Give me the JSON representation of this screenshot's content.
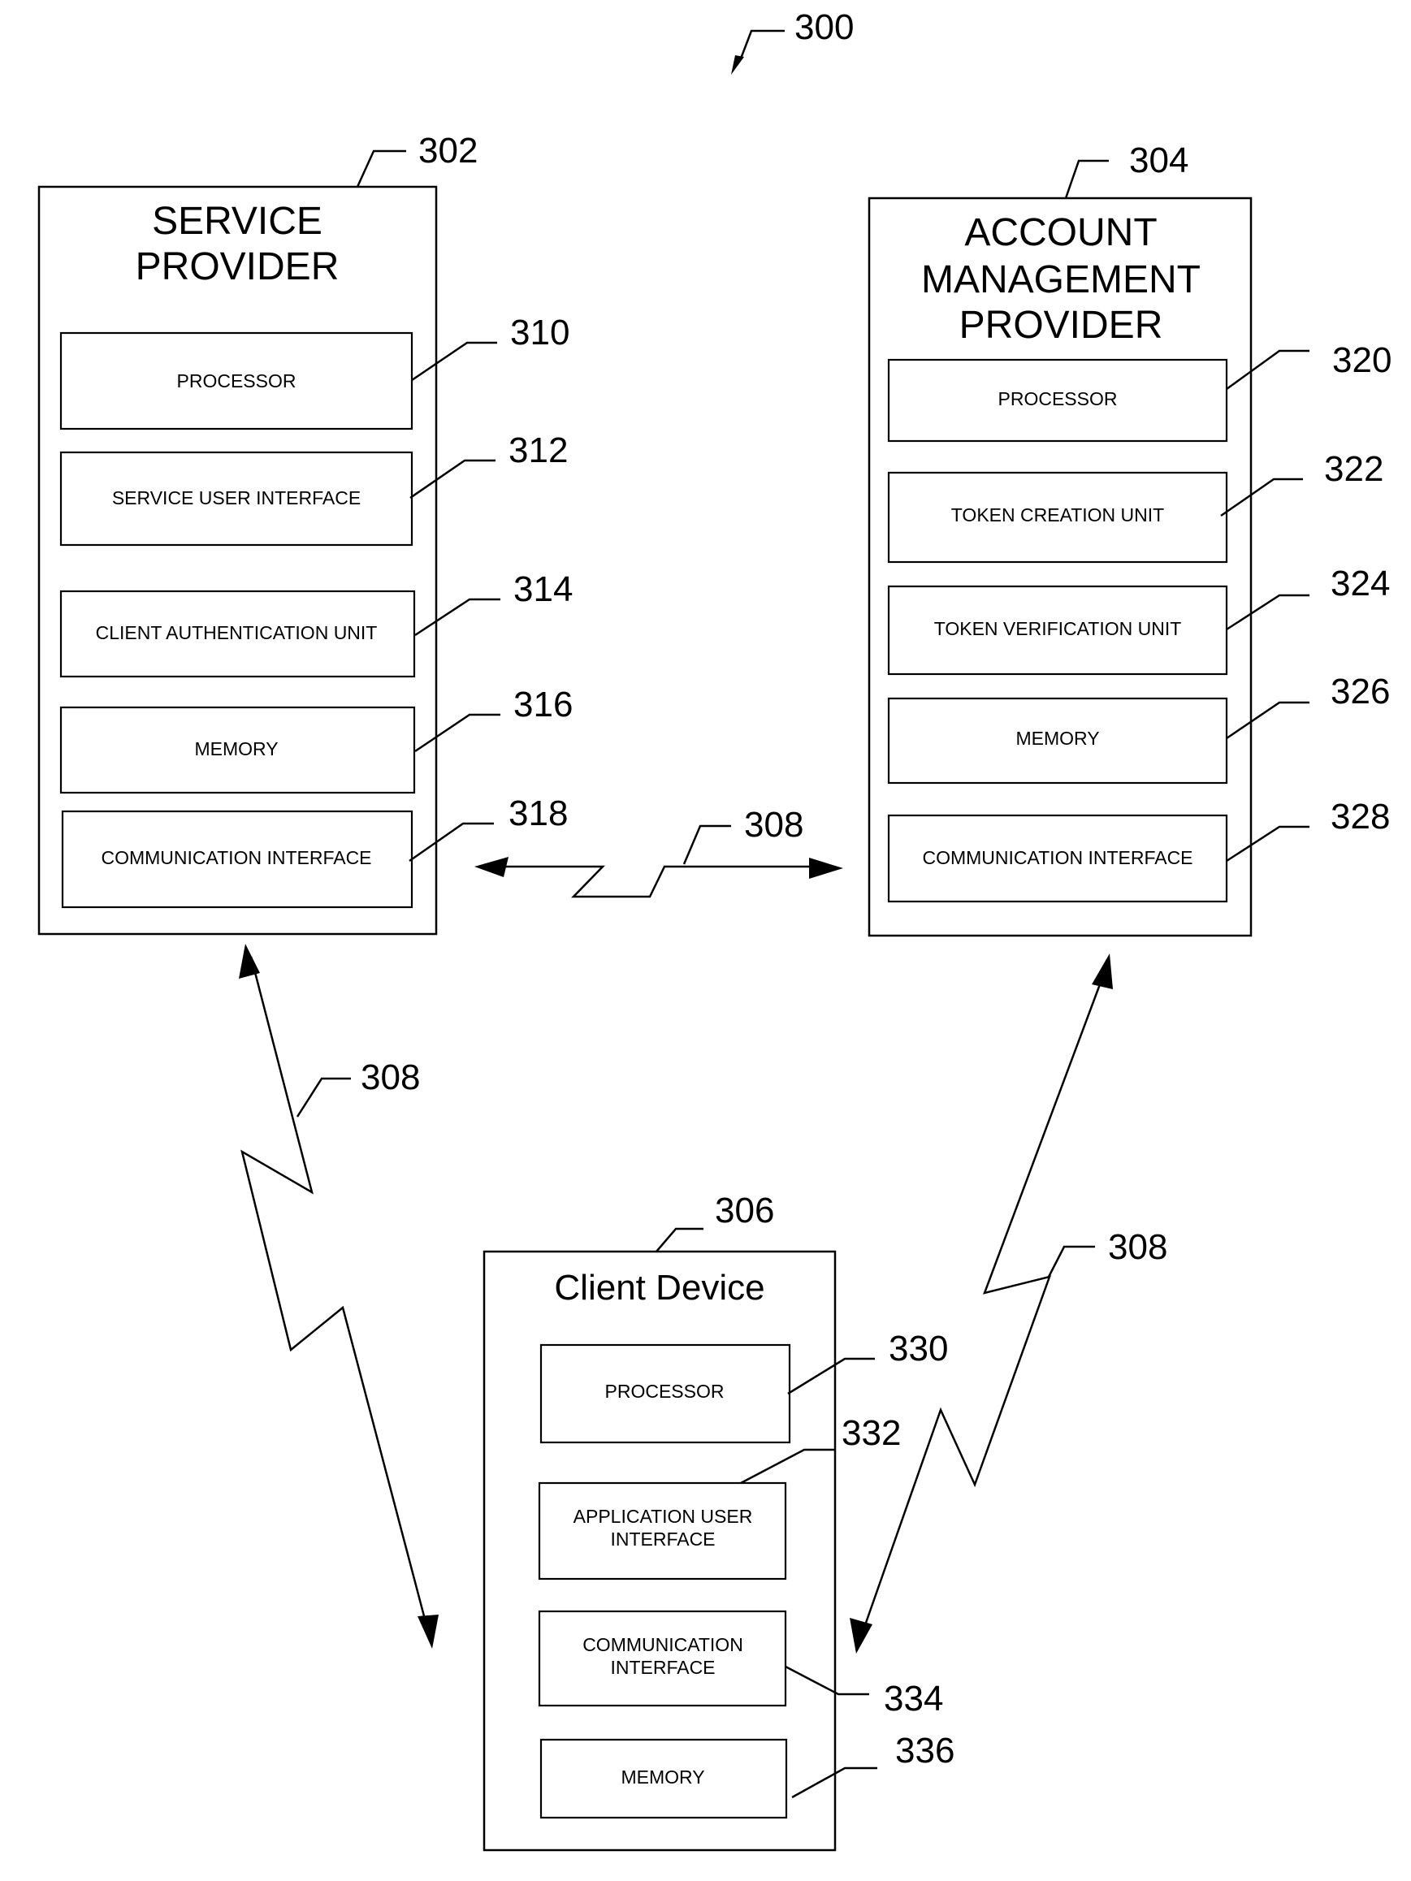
{
  "figure": {
    "ref": "300",
    "network_ref": "308"
  },
  "service_provider": {
    "ref": "302",
    "title": [
      "SERVICE",
      "PROVIDER"
    ],
    "components": [
      {
        "ref": "310",
        "label": [
          "PROCESSOR"
        ]
      },
      {
        "ref": "312",
        "label": [
          "SERVICE USER INTERFACE"
        ]
      },
      {
        "ref": "314",
        "label": [
          "CLIENT AUTHENTICATION UNIT"
        ]
      },
      {
        "ref": "316",
        "label": [
          "MEMORY"
        ]
      },
      {
        "ref": "318",
        "label": [
          "COMMUNICATION INTERFACE"
        ]
      }
    ]
  },
  "account_management_provider": {
    "ref": "304",
    "title": [
      "ACCOUNT",
      "MANAGEMENT",
      "PROVIDER"
    ],
    "components": [
      {
        "ref": "320",
        "label": [
          "PROCESSOR"
        ]
      },
      {
        "ref": "322",
        "label": [
          "TOKEN CREATION UNIT"
        ]
      },
      {
        "ref": "324",
        "label": [
          "TOKEN VERIFICATION UNIT"
        ]
      },
      {
        "ref": "326",
        "label": [
          "MEMORY"
        ]
      },
      {
        "ref": "328",
        "label": [
          "COMMUNICATION INTERFACE"
        ]
      }
    ]
  },
  "client_device": {
    "ref": "306",
    "title": [
      "Client Device"
    ],
    "components": [
      {
        "ref": "330",
        "label": [
          "PROCESSOR"
        ]
      },
      {
        "ref": "332",
        "label": [
          "APPLICATION USER",
          "INTERFACE"
        ]
      },
      {
        "ref": "334",
        "label": [
          "COMMUNICATION",
          "INTERFACE"
        ]
      },
      {
        "ref": "336",
        "label": [
          "MEMORY"
        ]
      }
    ]
  },
  "links": [
    {
      "ref": "308",
      "from": "service_provider",
      "to": "account_management_provider",
      "bidirectional": true
    },
    {
      "ref": "308",
      "from": "service_provider",
      "to": "client_device",
      "bidirectional": true
    },
    {
      "ref": "308",
      "from": "account_management_provider",
      "to": "client_device",
      "bidirectional": true
    }
  ]
}
